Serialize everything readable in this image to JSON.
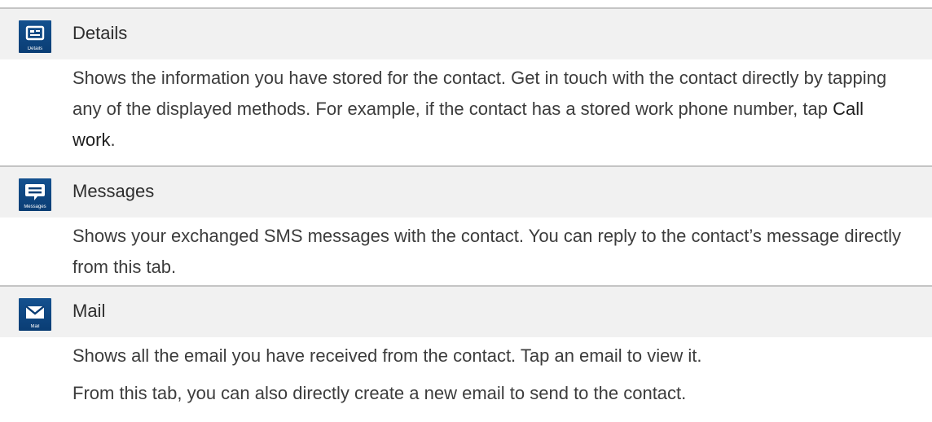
{
  "sections": [
    {
      "title": "Details",
      "icon": "contact-card-icon",
      "icon_caption": "Details",
      "paragraphs": [
        {
          "text_before": "Shows the information you have stored for the contact. Get in touch with the contact directly by tapping any of the displayed methods. For example, if the contact has a stored work phone number, tap ",
          "keyword": "Call work",
          "text_after": "."
        }
      ]
    },
    {
      "title": "Messages",
      "icon": "message-bubble-icon",
      "icon_caption": "Messages",
      "paragraphs": [
        {
          "text": "Shows your exchanged SMS messages with the contact. You can reply to the contact’s message directly from this tab."
        }
      ]
    },
    {
      "title": "Mail",
      "icon": "mail-envelope-icon",
      "icon_caption": "Mail",
      "paragraphs": [
        {
          "text": "Shows all the email you have received from the contact. Tap an email to view it."
        },
        {
          "text": "From this tab, you can also directly create a new email to send to the contact."
        }
      ]
    }
  ],
  "colors": {
    "header_band": "#f1f1f1",
    "divider": "#c4c4c4",
    "icon_blue": "#0a3d74"
  }
}
